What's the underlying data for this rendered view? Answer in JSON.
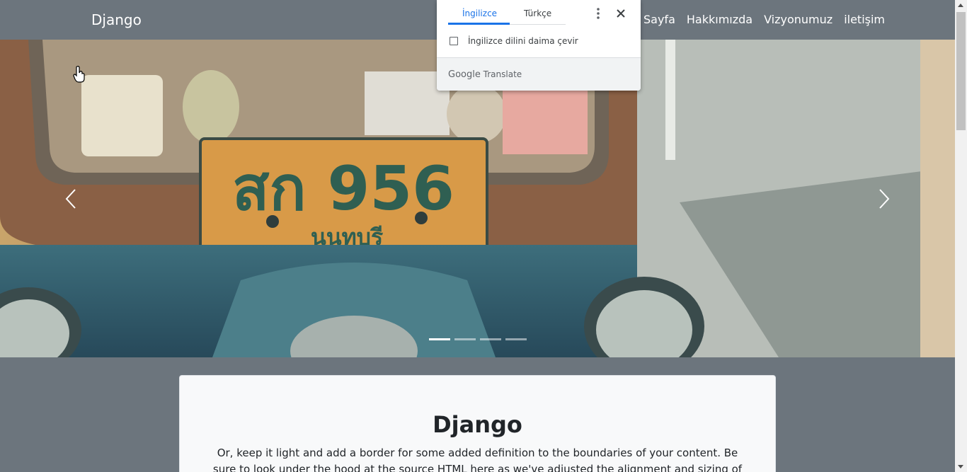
{
  "navbar": {
    "brand": "Django",
    "links": [
      "Sayfa",
      "Hakkımızda",
      "Vizyonumuz",
      "iletişim"
    ]
  },
  "carousel": {
    "image_description_icon": "tuk-tuk-license-plate-photo",
    "prev_icon": "chevron-left-icon",
    "next_icon": "chevron-right-icon",
    "slide_count": 4,
    "active_slide": 1
  },
  "card": {
    "title": "Django",
    "text": "Or, keep it light and add a border for some added definition to the boundaries of your content. Be sure to look under the hood at the source HTML here as we've adjusted the alignment and sizing of both"
  },
  "translate_popup": {
    "tabs": [
      "İngilizce",
      "Türkçe"
    ],
    "active_tab": "İngilizce",
    "checkbox_label": "İngilizce dilini daima çevir",
    "footer_brand": "Google",
    "footer_product": "Translate"
  },
  "colors": {
    "navbar_bg": "#6c757d",
    "accent": "#1a73e8",
    "card_bg": "#f8f9fa"
  }
}
